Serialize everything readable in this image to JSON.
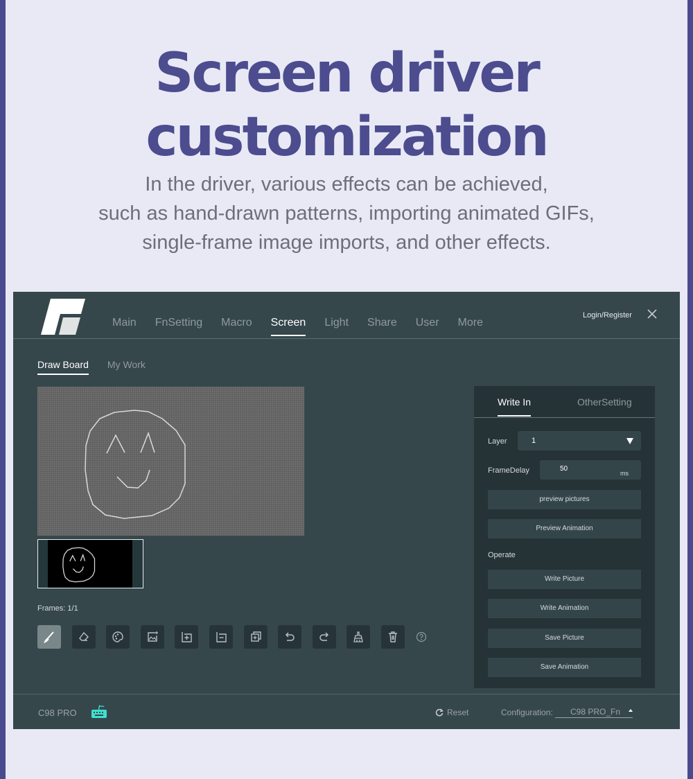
{
  "promo": {
    "headline_line1": "Screen driver",
    "headline_line2": "customization",
    "subtitle_line1": "In the driver, various effects can be achieved,",
    "subtitle_line2": "such as hand-drawn patterns, importing animated GIFs,",
    "subtitle_line3": "single-frame image imports, and other effects.",
    "accent_color": "#4c4c8f"
  },
  "app": {
    "nav": [
      {
        "label": "Main",
        "active": false
      },
      {
        "label": "FnSetting",
        "active": false
      },
      {
        "label": "Macro",
        "active": false
      },
      {
        "label": "Screen",
        "active": true
      },
      {
        "label": "Light",
        "active": false
      },
      {
        "label": "Share",
        "active": false
      },
      {
        "label": "User",
        "active": false
      },
      {
        "label": "More",
        "active": false
      }
    ],
    "login_label": "Login/Register",
    "close_icon": "close-icon",
    "subtabs": [
      {
        "label": "Draw Board",
        "active": true
      },
      {
        "label": "My Work",
        "active": false
      }
    ],
    "frames_label": "Frames: 1/1",
    "tools": [
      {
        "name": "brush-icon",
        "active": true
      },
      {
        "name": "eraser-icon",
        "active": false
      },
      {
        "name": "palette-icon",
        "active": false
      },
      {
        "name": "import-image-icon",
        "active": false
      },
      {
        "name": "add-frame-icon",
        "active": false
      },
      {
        "name": "remove-frame-icon",
        "active": false
      },
      {
        "name": "copy-frame-icon",
        "active": false
      },
      {
        "name": "undo-icon",
        "active": false
      },
      {
        "name": "redo-icon",
        "active": false
      },
      {
        "name": "clear-brush-icon",
        "active": false
      },
      {
        "name": "trash-icon",
        "active": false
      }
    ],
    "help_icon": "help-icon",
    "panel": {
      "tabs": [
        {
          "label": "Write In",
          "active": true
        },
        {
          "label": "OtherSetting",
          "active": false
        }
      ],
      "layer_label": "Layer",
      "layer_value": "1",
      "frame_delay_label": "FrameDelay",
      "frame_delay_value": "50",
      "frame_delay_unit": "ms",
      "preview_pictures": "preview pictures",
      "preview_animation": "Preview Animation",
      "operate_label": "Operate",
      "write_picture": "Write Picture",
      "write_animation": "Write Animation",
      "save_picture": "Save Picture",
      "save_animation": "Save Animation"
    },
    "footer": {
      "device_name": "C98 PRO",
      "device_icon_color": "#3de0d0",
      "reset_label": "Reset",
      "config_label": "Configuration:",
      "config_value": "C98 PRO_Fn"
    }
  }
}
